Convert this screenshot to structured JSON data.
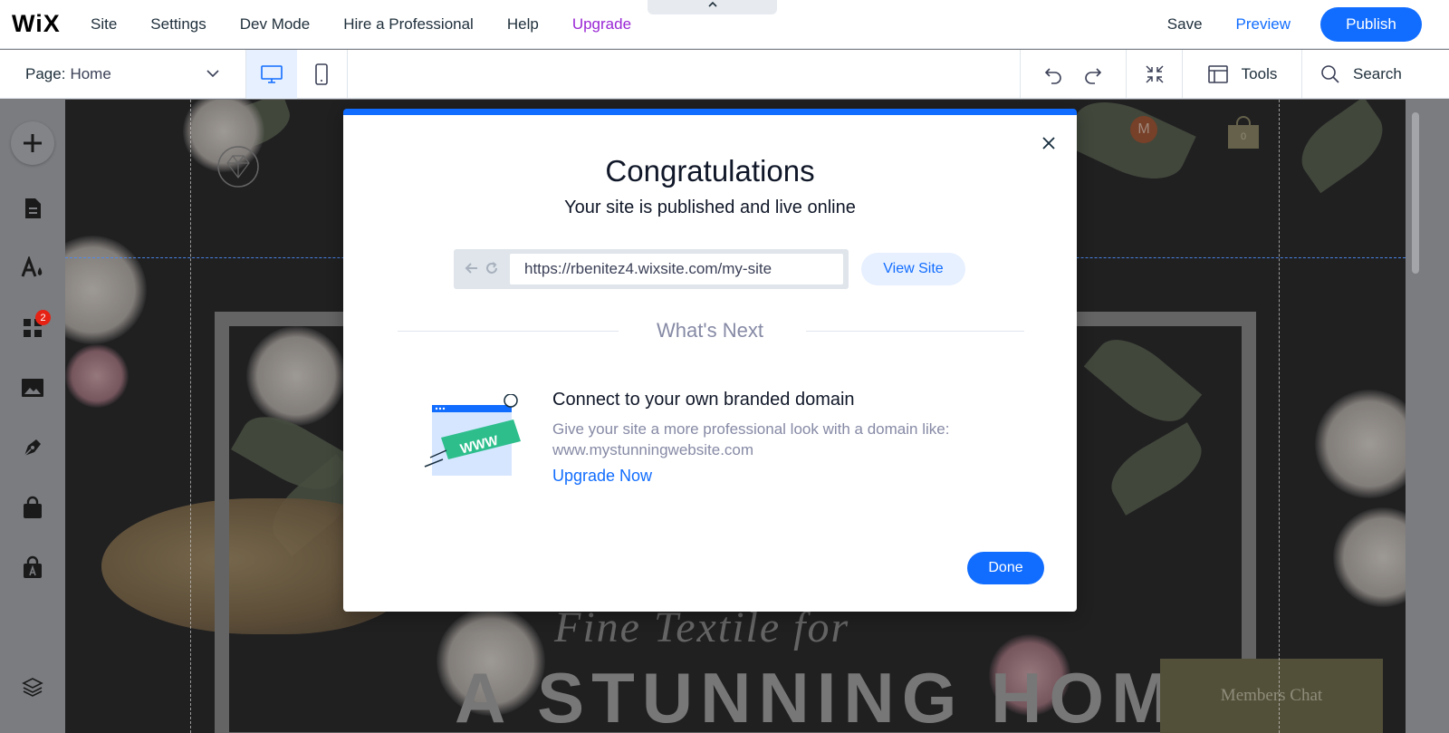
{
  "topbar": {
    "logo": "WiX",
    "nav": [
      "Site",
      "Settings",
      "Dev Mode",
      "Hire a Professional",
      "Help",
      "Upgrade"
    ],
    "save_label": "Save",
    "preview_label": "Preview",
    "publish_label": "Publish",
    "collapse_icon": "chevron-up-icon"
  },
  "subbar": {
    "page_prefix": "Page:",
    "page_value": "Home",
    "devices": [
      "desktop-icon",
      "mobile-icon"
    ],
    "active_device": "desktop",
    "tools_label": "Tools",
    "search_label": "Search"
  },
  "sidebar": {
    "items": [
      "add-icon",
      "pages-icon",
      "theme-icon",
      "apps-icon",
      "media-icon",
      "blog-icon",
      "store-icon",
      "bookings-icon",
      "layers-icon"
    ],
    "apps_badge": "2"
  },
  "canvas": {
    "avatar_letter": "M",
    "cart_count": "0",
    "hero_line1": "Fine Textile for",
    "hero_line2": "A STUNNING HOME",
    "members_chat": "Members Chat"
  },
  "modal": {
    "title": "Congratulations",
    "subtitle": "Your site is published and live online",
    "url": "https://rbenitez4.wixsite.com/my-site",
    "view_site_label": "View Site",
    "whats_next": "What's Next",
    "domain_title": "Connect to your own branded domain",
    "domain_desc": "Give your site a more professional look with a domain like: www.mystunningwebsite.com",
    "domain_link": "Upgrade Now",
    "illustration_text": "WWW",
    "done_label": "Done"
  },
  "colors": {
    "accent": "#116dff",
    "upgrade": "#9a27d5",
    "muted_text": "#868aa5",
    "badge": "#e62214"
  }
}
